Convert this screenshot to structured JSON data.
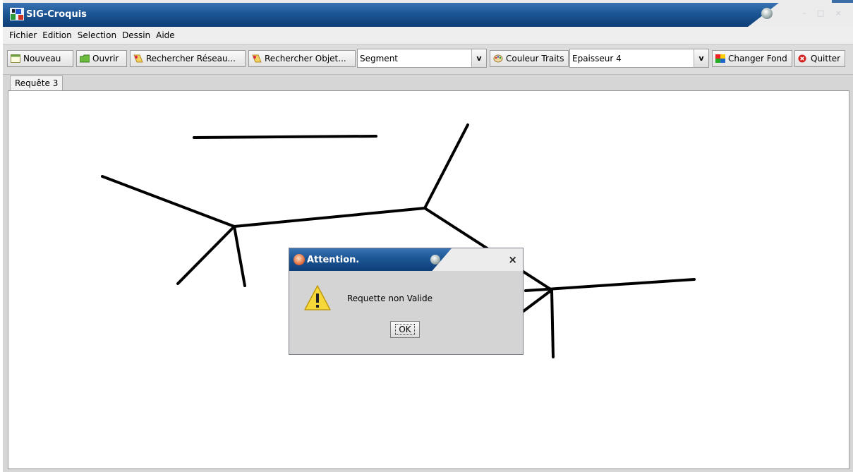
{
  "window": {
    "title": "SIG-Croquis",
    "controls": "– □ ×"
  },
  "menubar": {
    "items": [
      "Fichier",
      "Edition",
      "Selection",
      "Dessin",
      "Aide"
    ]
  },
  "toolbar": {
    "nouveau": "Nouveau",
    "ouvrir": "Ouvrir",
    "rechercher_reseau": "Rechercher Réseau...",
    "rechercher_objet": "Rechercher Objet...",
    "shape_select": "Segment",
    "couleur_traits": "Couleur Traits",
    "thickness_select": "Epaisseur 4",
    "changer_fond": "Changer Fond",
    "quitter": "Quitter",
    "combo_arrow": "v"
  },
  "tabs": [
    {
      "label": "Requête 3"
    }
  ],
  "dialog": {
    "title": "Attention.",
    "close": "×",
    "message": "Requette non Valide",
    "ok": "OK"
  },
  "colors": {
    "titlebar": "#1d5594",
    "canvas": "#ffffff",
    "stroke": "#000000"
  }
}
